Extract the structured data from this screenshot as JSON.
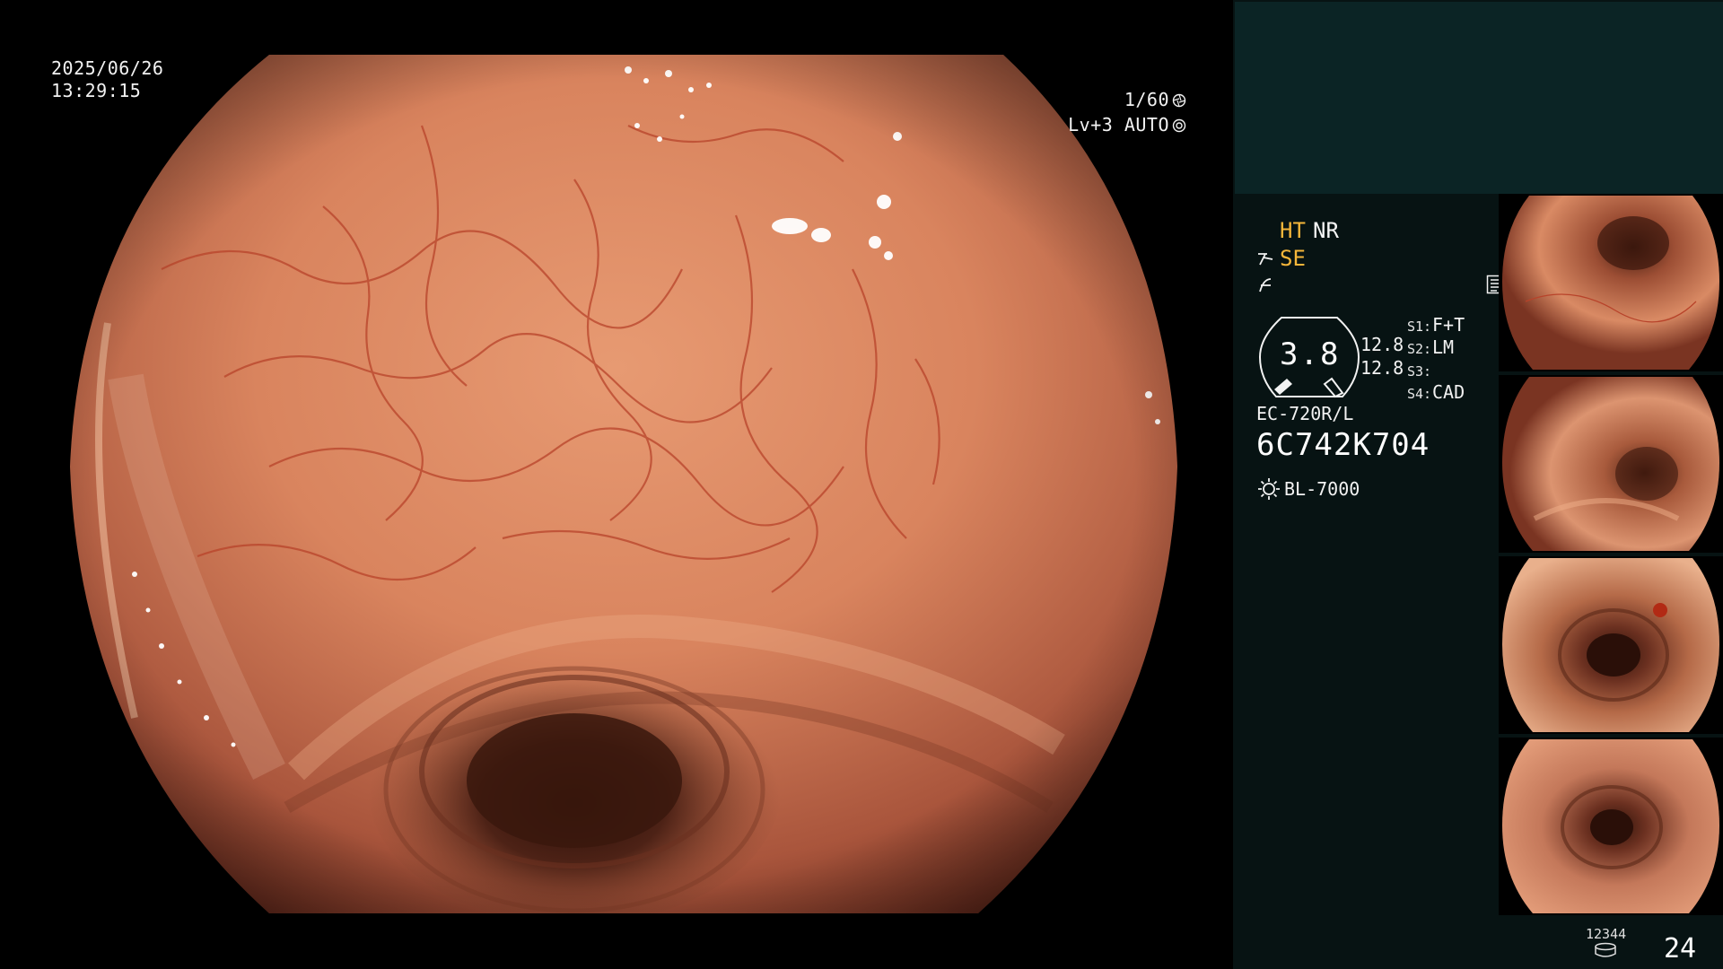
{
  "osd": {
    "date": "2025/06/26",
    "time": "13:29:15",
    "shutter": "1/60",
    "shutter_icon": "shutter-icon",
    "level": "Lv+3 AUTO",
    "level_icon": "auto-iris-icon"
  },
  "panel": {
    "modes": {
      "ht": "HT",
      "nr": "NR",
      "se": "SE"
    },
    "mode_color": "#f5b63a",
    "gauge_value": "3.8",
    "value_a": "12.8",
    "value_b": "12.8",
    "slots": [
      {
        "label": "S1:",
        "value": "F+T"
      },
      {
        "label": "S2:",
        "value": "LM"
      },
      {
        "label": "S3:",
        "value": ""
      },
      {
        "label": "S4:",
        "value": "CAD"
      }
    ],
    "asterisk": "*",
    "scope_model": "EC-720R/L",
    "scope_serial": "6C742K704",
    "light_source": "BL-7000",
    "counter_small": "12344",
    "counter_big": "24"
  },
  "thumbnails": [
    {
      "id": 1,
      "label": "endoscopic capture 1"
    },
    {
      "id": 2,
      "label": "endoscopic capture 2"
    },
    {
      "id": 3,
      "label": "endoscopic capture 3"
    },
    {
      "id": 4,
      "label": "endoscopic capture 4"
    }
  ],
  "colors": {
    "panel_bg": "#071313",
    "panel_top_bg": "#0b2425",
    "mucosa": "#d9845e"
  }
}
